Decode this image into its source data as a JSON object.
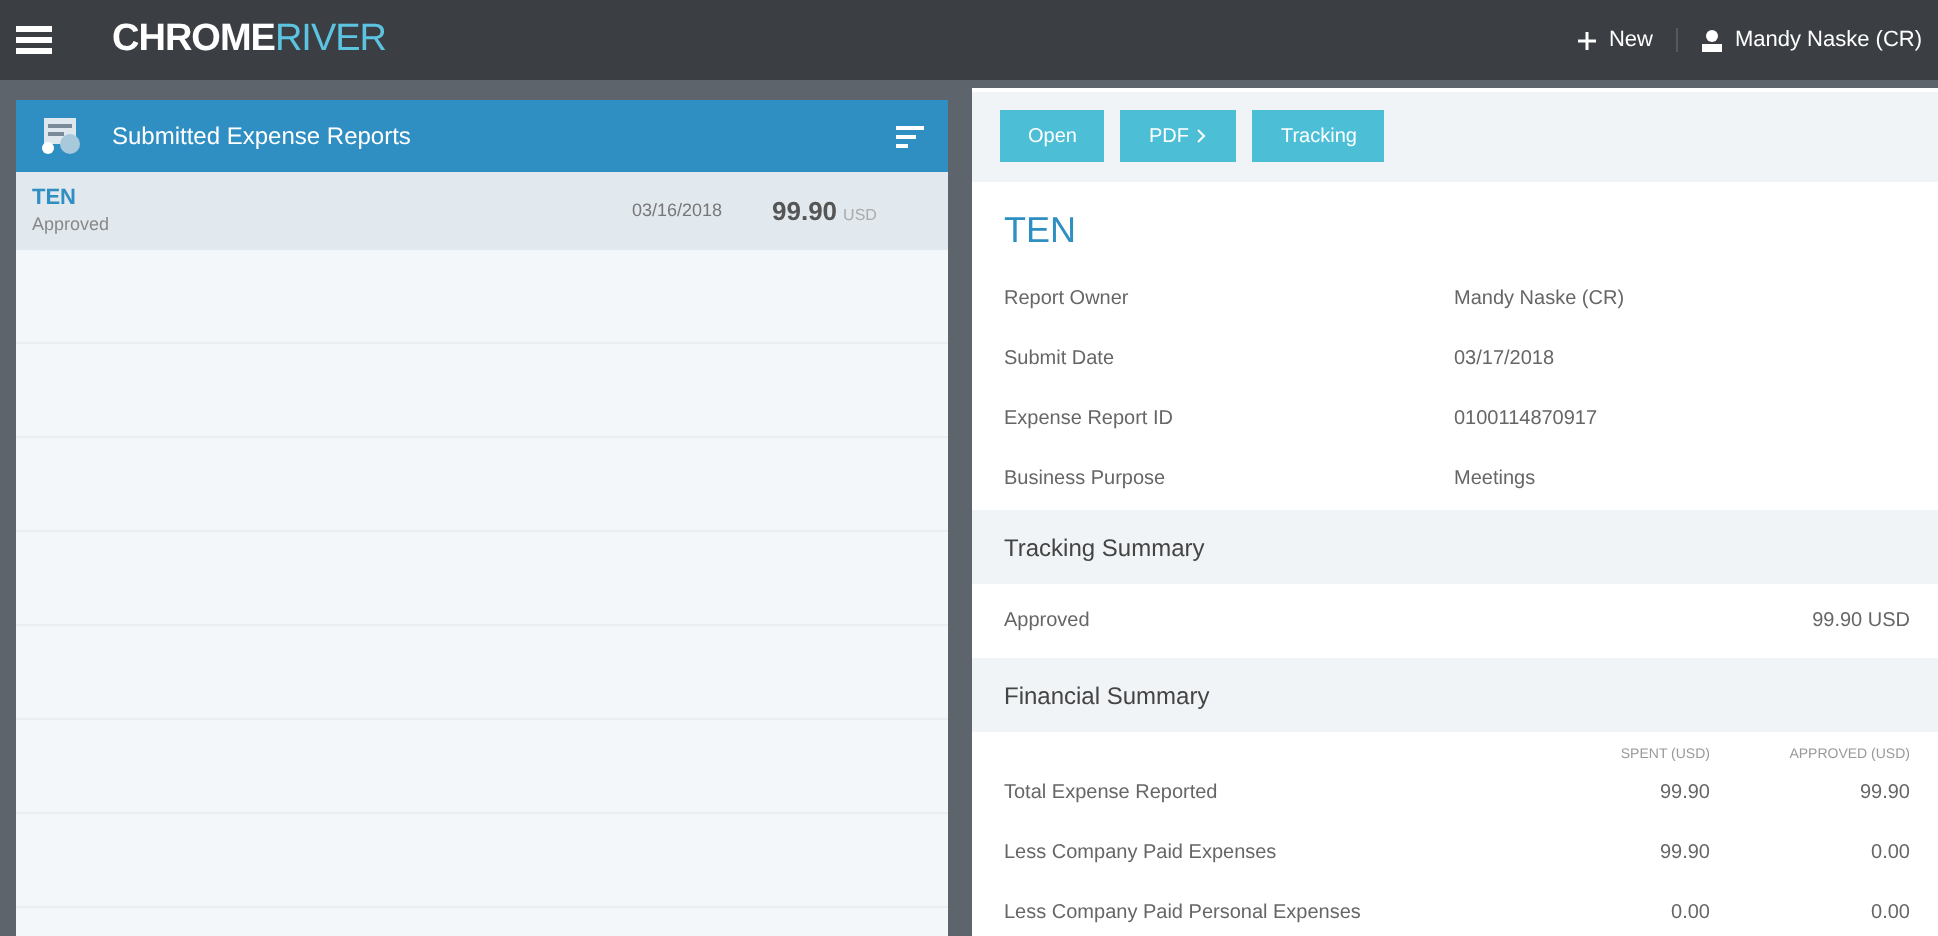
{
  "top_bar": {
    "logo_dark": "CHROME",
    "logo_light": "RIVER",
    "new_label": "New",
    "user_name": "Mandy Naske (CR)"
  },
  "list_panel": {
    "title": "Submitted Expense Reports",
    "reports": [
      {
        "name": "TEN",
        "status": "Approved",
        "date": "03/16/2018",
        "amount": "99.90",
        "currency": "USD",
        "selected": true
      }
    ]
  },
  "detail": {
    "buttons": [
      {
        "label": "Open",
        "kind": "plain"
      },
      {
        "label": "PDF",
        "kind": "dropdown"
      },
      {
        "label": "Tracking",
        "kind": "plain"
      }
    ],
    "title": "TEN",
    "fields": [
      {
        "label": "Report Owner",
        "value": "Mandy Naske (CR)"
      },
      {
        "label": "Submit Date",
        "value": "03/17/2018"
      },
      {
        "label": "Expense Report ID",
        "value": "0100114870917"
      },
      {
        "label": "Business Purpose",
        "value": "Meetings"
      }
    ],
    "tracking_summary": {
      "title": "Tracking Summary",
      "status": "Approved",
      "amount": "99.90 USD"
    },
    "financial_summary": {
      "title": "Financial Summary",
      "columns": [
        "SPENT (USD)",
        "APPROVED (USD)"
      ],
      "rows": [
        {
          "label": "Total Expense Reported",
          "values": [
            "99.90",
            "99.90"
          ]
        },
        {
          "label": "Less Company Paid Expenses",
          "values": [
            "99.90",
            "0.00"
          ]
        },
        {
          "label": "Less Company Paid Personal Expenses",
          "values": [
            "0.00",
            "0.00"
          ]
        }
      ]
    }
  }
}
